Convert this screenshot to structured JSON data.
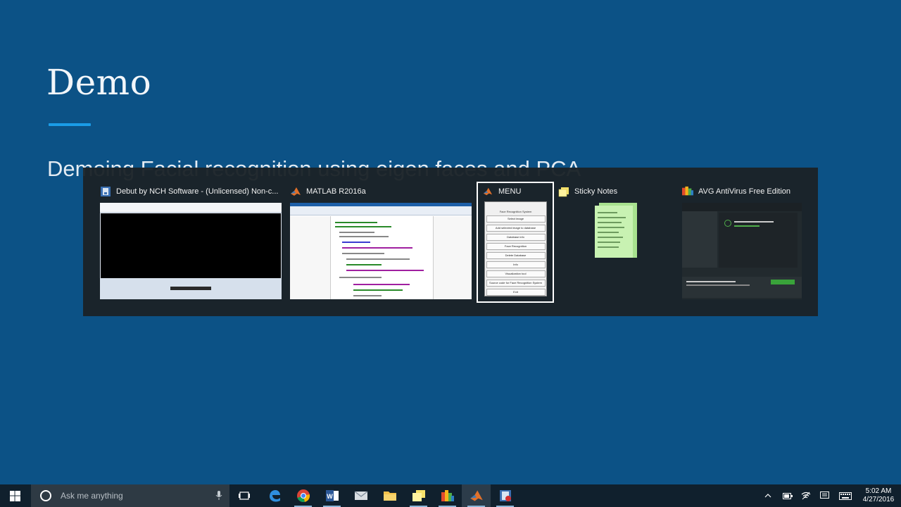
{
  "slide": {
    "title": "Demo",
    "subtitle": "Demoing Facial recognition using eigen faces and PCA"
  },
  "switcher": {
    "windows": [
      {
        "title": "Debut by NCH Software - (Unlicensed) Non-c..."
      },
      {
        "title": "MATLAB R2016a"
      },
      {
        "title": "MENU",
        "selected": true,
        "menu_heading": "Face Recognition System",
        "buttons": [
          "Select image",
          "Add selected image to database",
          "Database info",
          "Face Recognition",
          "Delete Database",
          "Info",
          "Visualization tool",
          "Source code for Face Recognition System",
          "Exit"
        ]
      },
      {
        "title": "Sticky Notes"
      },
      {
        "title": "AVG AntiVirus Free Edition"
      }
    ]
  },
  "taskbar": {
    "search_placeholder": "Ask me anything",
    "clock_time": "5:02 AM",
    "clock_date": "4/27/2016",
    "apps": [
      "edge",
      "chrome",
      "word",
      "mail",
      "file-explorer",
      "sticky-notes",
      "avg",
      "matlab",
      "debut"
    ]
  },
  "colors": {
    "slide_background": "#0c5286",
    "accent_rule": "#1a9ce8",
    "switcher_background": "#1b2228",
    "taskbar_background": "#10202d"
  }
}
